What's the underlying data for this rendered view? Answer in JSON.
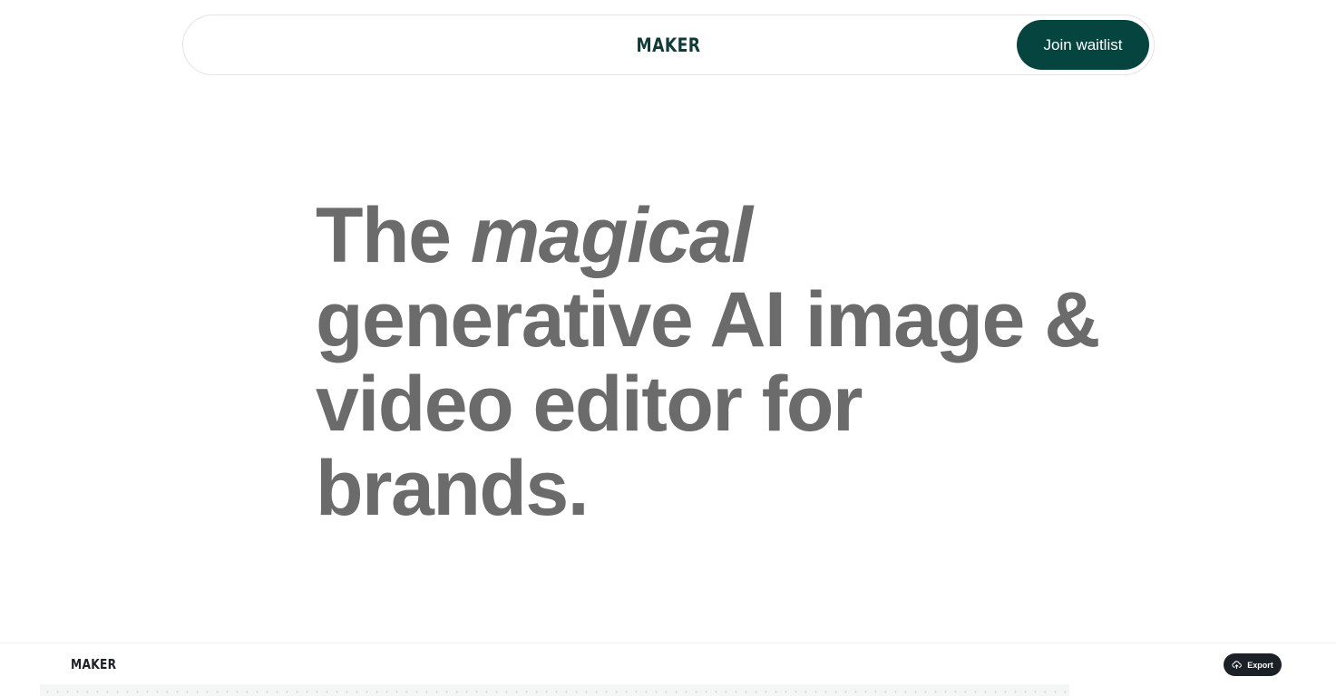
{
  "header": {
    "logo": "MAKER",
    "cta_label": "Join waitlist",
    "cta_color": "#06453f"
  },
  "hero": {
    "line1_plain": "The ",
    "line1_em": "magical",
    "line2": "generative AI image &",
    "line3": "video editor for",
    "line4": "brands."
  },
  "app_preview": {
    "logo": "MAKER",
    "export_label": "Export",
    "export_icon": "cloud-upload-icon"
  }
}
